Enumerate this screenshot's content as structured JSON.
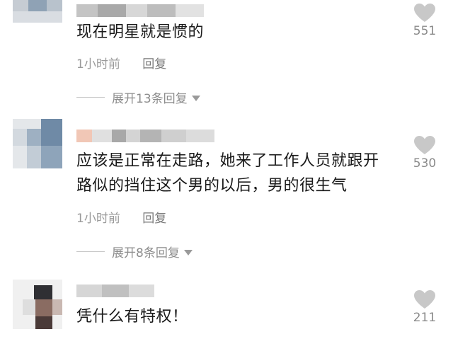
{
  "comments": [
    {
      "text": "现在明星就是惯的",
      "time": "1小时前",
      "reply_label": "回复",
      "expand_label": "展开13条回复",
      "likes": "551"
    },
    {
      "text": "应该是正常在走路，她来了工作人员就跟开路似的挡住这个男的以后，男的很生气",
      "time": "1小时前",
      "reply_label": "回复",
      "expand_label": "展开8条回复",
      "likes": "530"
    },
    {
      "text": "凭什么有特权！",
      "likes": "211"
    }
  ],
  "colors": {
    "text": "#1a1a1a",
    "meta": "#9a9a9a",
    "heart": "#c8c8c8"
  },
  "icons": {
    "like": "heart-icon",
    "expand": "triangle-down-icon"
  }
}
